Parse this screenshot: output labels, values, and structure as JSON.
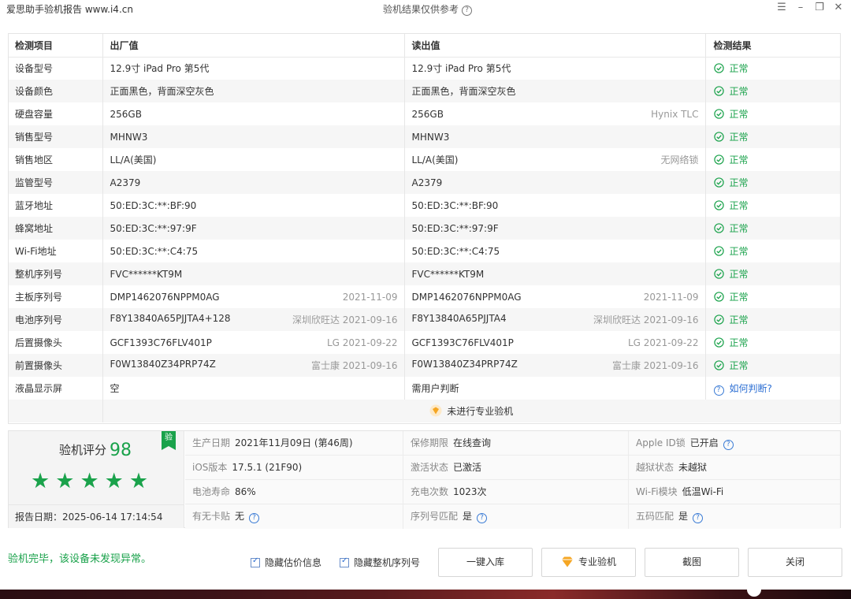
{
  "window": {
    "app_title": "爱思助手验机报告 www.i4.cn",
    "center_title": "验机结果仅供参考"
  },
  "table": {
    "headers": {
      "item": "检测项目",
      "factory": "出厂值",
      "read": "读出值",
      "result": "检测结果"
    },
    "rows": [
      {
        "item": "设备型号",
        "factory": "12.9寸 iPad Pro 第5代",
        "factory_note": "",
        "read": "12.9寸 iPad Pro 第5代",
        "read_note": "",
        "result": "正常",
        "status": "ok"
      },
      {
        "item": "设备颜色",
        "factory": "正面黑色，背面深空灰色",
        "factory_note": "",
        "read": "正面黑色，背面深空灰色",
        "read_note": "",
        "result": "正常",
        "status": "ok"
      },
      {
        "item": "硬盘容量",
        "factory": "256GB",
        "factory_note": "",
        "read": "256GB",
        "read_note": "Hynix TLC",
        "result": "正常",
        "status": "ok"
      },
      {
        "item": "销售型号",
        "factory": "MHNW3",
        "factory_note": "",
        "read": "MHNW3",
        "read_note": "",
        "result": "正常",
        "status": "ok"
      },
      {
        "item": "销售地区",
        "factory": "LL/A(美国)",
        "factory_note": "",
        "read": "LL/A(美国)",
        "read_note": "无网络锁",
        "result": "正常",
        "status": "ok"
      },
      {
        "item": "监管型号",
        "factory": "A2379",
        "factory_note": "",
        "read": "A2379",
        "read_note": "",
        "result": "正常",
        "status": "ok"
      },
      {
        "item": "蓝牙地址",
        "factory": "50:ED:3C:**:BF:90",
        "factory_note": "",
        "read": "50:ED:3C:**:BF:90",
        "read_note": "",
        "result": "正常",
        "status": "ok"
      },
      {
        "item": "蜂窝地址",
        "factory": "50:ED:3C:**:97:9F",
        "factory_note": "",
        "read": "50:ED:3C:**:97:9F",
        "read_note": "",
        "result": "正常",
        "status": "ok"
      },
      {
        "item": "Wi-Fi地址",
        "factory": "50:ED:3C:**:C4:75",
        "factory_note": "",
        "read": "50:ED:3C:**:C4:75",
        "read_note": "",
        "result": "正常",
        "status": "ok"
      },
      {
        "item": "整机序列号",
        "factory": "FVC******KT9M",
        "factory_note": "",
        "read": "FVC******KT9M",
        "read_note": "",
        "result": "正常",
        "status": "ok"
      },
      {
        "item": "主板序列号",
        "factory": "DMP1462076NPPM0AG",
        "factory_note": "2021-11-09",
        "read": "DMP1462076NPPM0AG",
        "read_note": "2021-11-09",
        "result": "正常",
        "status": "ok"
      },
      {
        "item": "电池序列号",
        "factory": "F8Y13840A65PJJTA4+128",
        "factory_note": "深圳欣旺达 2021-09-16",
        "read": "F8Y13840A65PJJTA4",
        "read_note": "深圳欣旺达 2021-09-16",
        "result": "正常",
        "status": "ok"
      },
      {
        "item": "后置摄像头",
        "factory": "GCF1393C76FLV401P",
        "factory_note": "LG 2021-09-22",
        "read": "GCF1393C76FLV401P",
        "read_note": "LG 2021-09-22",
        "result": "正常",
        "status": "ok"
      },
      {
        "item": "前置摄像头",
        "factory": "F0W13840Z34PRP74Z",
        "factory_note": "富士康 2021-09-16",
        "read": "F0W13840Z34PRP74Z",
        "read_note": "富士康 2021-09-16",
        "result": "正常",
        "status": "ok"
      },
      {
        "item": "液晶显示屏",
        "factory": "空",
        "factory_note": "",
        "read": "需用户判断",
        "read_note": "",
        "result": "如何判断?",
        "status": "question"
      }
    ],
    "pro_check_text": "未进行专业验机"
  },
  "summary": {
    "score_label": "验机评分",
    "score": "98",
    "stars": 5,
    "badge": "验",
    "report_date": "报告日期：2025-06-14 17:14:54",
    "cells": [
      {
        "label": "生产日期",
        "value": "2021年11月09日 (第46周)",
        "style": "normal",
        "help": false
      },
      {
        "label": "保修期限",
        "value": "在线查询",
        "style": "blue",
        "help": false
      },
      {
        "label": "Apple ID锁",
        "value": "已开启",
        "style": "red",
        "help": true
      },
      {
        "label": "iOS版本",
        "value": "17.5.1 (21F90)",
        "style": "normal",
        "help": false
      },
      {
        "label": "激活状态",
        "value": "已激活",
        "style": "normal",
        "help": false
      },
      {
        "label": "越狱状态",
        "value": "未越狱",
        "style": "normal",
        "help": false
      },
      {
        "label": "电池寿命",
        "value": "86%",
        "style": "normal",
        "help": false
      },
      {
        "label": "充电次数",
        "value": "1023次",
        "style": "normal",
        "help": false
      },
      {
        "label": "Wi-Fi模块",
        "value": "低温Wi-Fi",
        "style": "normal",
        "help": false
      },
      {
        "label": "有无卡贴",
        "value": "无",
        "style": "green",
        "help": true
      },
      {
        "label": "序列号匹配",
        "value": "是",
        "style": "green",
        "help": true
      },
      {
        "label": "五码匹配",
        "value": "是",
        "style": "green",
        "help": true
      }
    ]
  },
  "footer": {
    "message": "验机完毕，该设备未发现异常。",
    "checkbox_hide_price": "隐藏估价信息",
    "checkbox_hide_serial": "隐藏整机序列号",
    "btn_inventory": "一键入库",
    "btn_pro_check": "专业验机",
    "btn_screenshot": "截图",
    "btn_close": "关闭"
  },
  "colors": {
    "ok_green": "#1aa24b",
    "link_blue": "#2d6fd3",
    "warn_red": "#e23c3c",
    "accent_orange": "#f5a623"
  }
}
